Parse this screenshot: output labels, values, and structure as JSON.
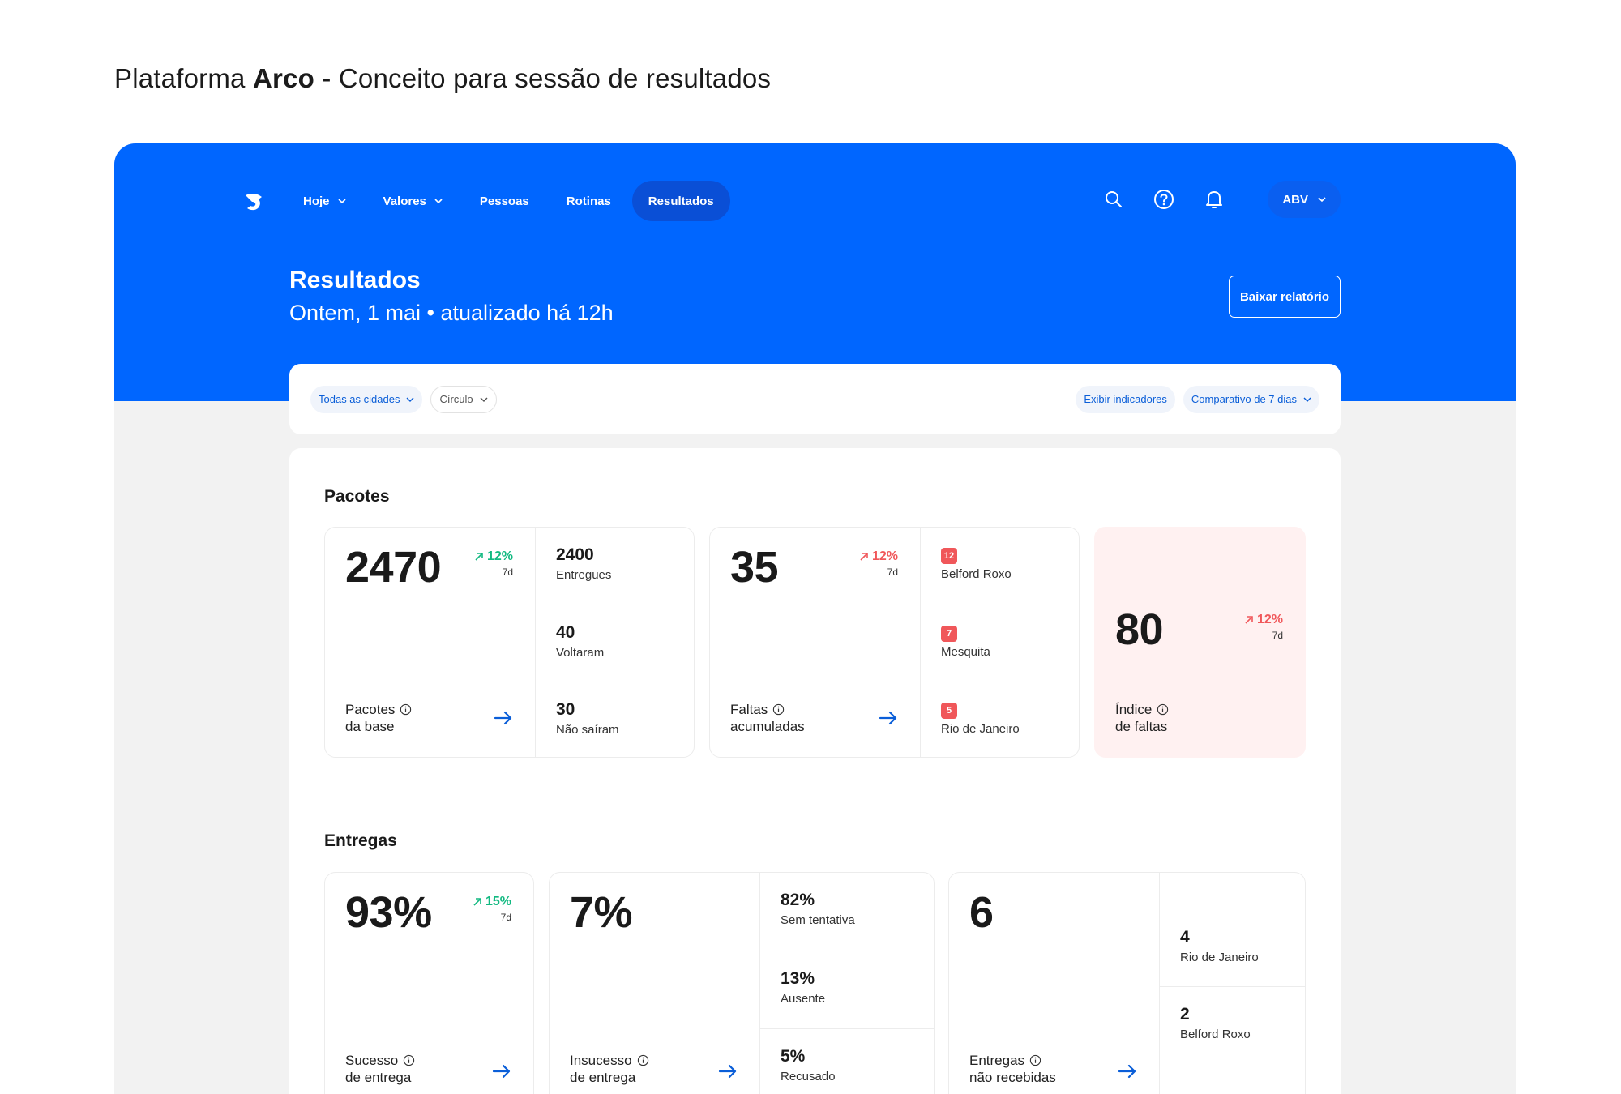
{
  "caption": {
    "prefix": "Plataforma ",
    "brand": "Arco",
    "suffix": " - Conceito para sessão de resultados"
  },
  "nav": {
    "items": [
      {
        "label": "Hoje",
        "dropdown": true
      },
      {
        "label": "Valores",
        "dropdown": true
      },
      {
        "label": "Pessoas",
        "dropdown": false
      },
      {
        "label": "Rotinas",
        "dropdown": false
      },
      {
        "label": "Resultados",
        "dropdown": false,
        "active": true
      }
    ],
    "user": "ABV"
  },
  "header": {
    "title": "Resultados",
    "subtitle": "Ontem, 1 mai • atualizado há 12h",
    "download_label": "Baixar relatório"
  },
  "filters": {
    "city": "Todas as cidades",
    "circle": "Círculo",
    "show_indicators": "Exibir indicadores",
    "comparison": "Comparativo de 7 dias"
  },
  "pacotes": {
    "title": "Pacotes",
    "base": {
      "value": "2470",
      "trend": "12%",
      "period": "7d",
      "label_1": "Pacotes",
      "label_2": "da base",
      "rows": [
        {
          "value": "2400",
          "caption": "Entregues"
        },
        {
          "value": "40",
          "caption": "Voltaram"
        },
        {
          "value": "30",
          "caption": "Não saíram"
        }
      ]
    },
    "faltas": {
      "value": "35",
      "trend": "12%",
      "period": "7d",
      "label_1": "Faltas",
      "label_2": "acumuladas",
      "rows": [
        {
          "badge": "12",
          "caption": "Belford Roxo"
        },
        {
          "badge": "7",
          "caption": "Mesquita"
        },
        {
          "badge": "5",
          "caption": "Rio de Janeiro"
        }
      ]
    },
    "indice": {
      "value": "80",
      "trend": "12%",
      "period": "7d",
      "label_1": "Índice",
      "label_2": "de faltas"
    }
  },
  "entregas": {
    "title": "Entregas",
    "sucesso": {
      "value": "93%",
      "trend": "15%",
      "period": "7d",
      "label_1": "Sucesso",
      "label_2": "de entrega"
    },
    "insucesso": {
      "value": "7%",
      "label_1": "Insucesso",
      "label_2": "de entrega",
      "rows": [
        {
          "value": "82%",
          "caption": "Sem tentativa"
        },
        {
          "value": "13%",
          "caption": "Ausente"
        },
        {
          "value": "5%",
          "caption": "Recusado"
        }
      ]
    },
    "nao_recebidas": {
      "value": "6",
      "label_1": "Entregas",
      "label_2": "não recebidas",
      "rows": [
        {
          "value": "4",
          "caption": "Rio de Janeiro"
        },
        {
          "value": "2",
          "caption": "Belford Roxo"
        }
      ]
    }
  },
  "colors": {
    "brand": "#0066ff",
    "positive": "#12b981",
    "negative": "#f0575a",
    "alert_bg": "#fff1f1"
  }
}
